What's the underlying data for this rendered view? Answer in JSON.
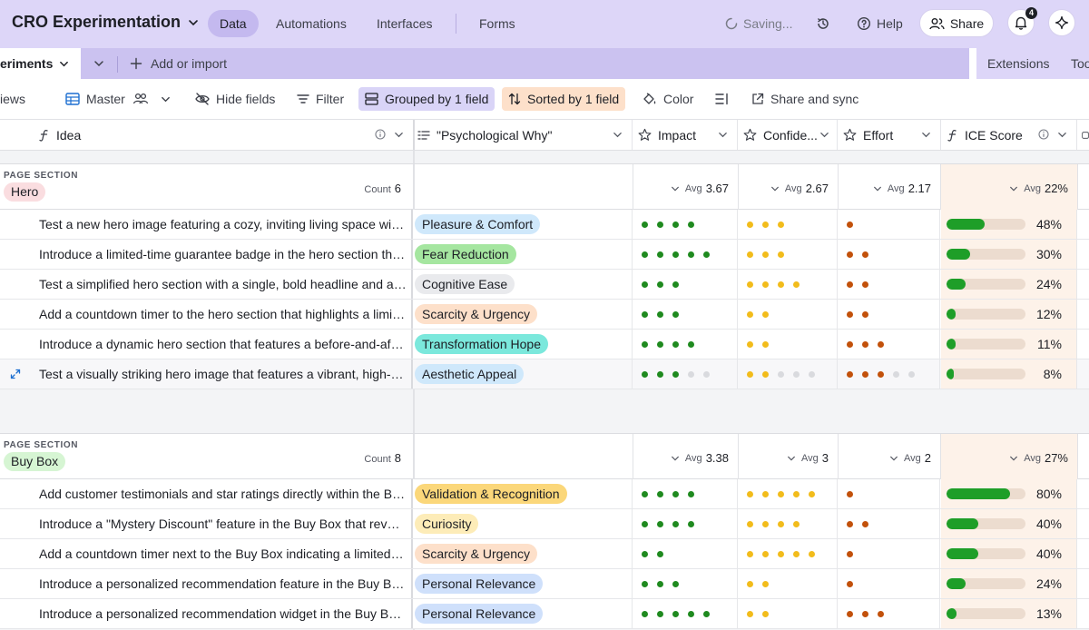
{
  "app": {
    "title": "CRO Experimentation",
    "nav_tabs": [
      {
        "label": "Data",
        "active": true
      },
      {
        "label": "Automations",
        "active": false
      },
      {
        "label": "Interfaces",
        "active": false
      },
      {
        "label": "Forms",
        "active": false
      }
    ],
    "saving_label": "Saving...",
    "help_label": "Help",
    "share_label": "Share",
    "notification_count": "4"
  },
  "tabbar": {
    "table_tab_label": "eriments",
    "add_import_label": "Add or import",
    "extensions_label": "Extensions",
    "tools_label": "Too"
  },
  "toolbar": {
    "views_label": "iews",
    "view_name": "Master",
    "hide_fields": "Hide fields",
    "filter": "Filter",
    "grouped": "Grouped by 1 field",
    "sorted": "Sorted by 1 field",
    "color": "Color",
    "share_sync": "Share and sync"
  },
  "columns": {
    "idea": "Idea",
    "why": "\"Psychological Why\"",
    "impact": "Impact",
    "confidence": "Confide...",
    "effort": "Effort",
    "ice": "ICE Score"
  },
  "colors": {
    "green": "#1f8a1f",
    "yellow": "#f2bc1b",
    "orange": "#c2510b",
    "empty": "#d9dade"
  },
  "groups": [
    {
      "section_label": "PAGE SECTION",
      "name": "Hero",
      "pill_color": "#fadde0",
      "count_label": "Count",
      "count": "6",
      "avg_label": "Avg",
      "avg_impact": "3.67",
      "avg_confidence": "2.67",
      "avg_effort": "2.17",
      "avg_ice": "22%",
      "rows": [
        {
          "idea": "Test a new hero image featuring a cozy, inviting living space with warm lighting and comfortable furniture",
          "why": "Pleasure & Comfort",
          "why_color": "#cfe8fb",
          "impact": 4,
          "impact_max": 4,
          "confidence": 3,
          "confidence_max": 3,
          "effort": 1,
          "effort_max": 1,
          "ice": "48%",
          "ice_fraction": 0.48
        },
        {
          "idea": "Introduce a limited-time guarantee badge in the hero section that emphasizes risk-free shopping",
          "why": "Fear Reduction",
          "why_color": "#a5e6a0",
          "impact": 5,
          "impact_max": 5,
          "confidence": 3,
          "confidence_max": 3,
          "effort": 2,
          "effort_max": 2,
          "ice": "30%",
          "ice_fraction": 0.3
        },
        {
          "idea": "Test a simplified hero section with a single, bold headline and a clear call to action",
          "why": "Cognitive Ease",
          "why_color": "#e9eaed",
          "impact": 3,
          "impact_max": 3,
          "confidence": 4,
          "confidence_max": 4,
          "effort": 2,
          "effort_max": 2,
          "ice": "24%",
          "ice_fraction": 0.24
        },
        {
          "idea": "Add a countdown timer to the hero section that highlights a limited-time offer",
          "why": "Scarcity & Urgency",
          "why_color": "#fde0ca",
          "impact": 3,
          "impact_max": 3,
          "confidence": 2,
          "confidence_max": 2,
          "effort": 2,
          "effort_max": 2,
          "ice": "12%",
          "ice_fraction": 0.12
        },
        {
          "idea": "Introduce a dynamic hero section that features a before-and-after transformation of a room",
          "why": "Transformation Hope",
          "why_color": "#7be8dc",
          "impact": 4,
          "impact_max": 4,
          "confidence": 2,
          "confidence_max": 2,
          "effort": 3,
          "effort_max": 3,
          "ice": "11%",
          "ice_fraction": 0.11
        },
        {
          "idea": "Test a visually striking hero image that features a vibrant, high-quality lifestyle scene",
          "why": "Aesthetic Appeal",
          "why_color": "#cfe8fb",
          "impact": 3,
          "impact_max": 5,
          "confidence": 2,
          "confidence_max": 5,
          "effort": 3,
          "effort_max": 5,
          "ice": "8%",
          "ice_fraction": 0.08,
          "hover": true
        }
      ]
    },
    {
      "section_label": "PAGE SECTION",
      "name": "Buy Box",
      "pill_color": "#d6f5d3",
      "count_label": "Count",
      "count": "8",
      "avg_label": "Avg",
      "avg_impact": "3.38",
      "avg_confidence": "3",
      "avg_effort": "2",
      "avg_ice": "27%",
      "rows": [
        {
          "idea": "Add customer testimonials and star ratings directly within the Buy Box",
          "why": "Validation & Recognition",
          "why_color": "#fbd77a",
          "impact": 4,
          "impact_max": 4,
          "confidence": 5,
          "confidence_max": 5,
          "effort": 1,
          "effort_max": 1,
          "ice": "80%",
          "ice_fraction": 0.8
        },
        {
          "idea": "Introduce a \"Mystery Discount\" feature in the Buy Box that reveals a surprise discount",
          "why": "Curiosity",
          "why_color": "#fdecb8",
          "impact": 4,
          "impact_max": 4,
          "confidence": 4,
          "confidence_max": 4,
          "effort": 2,
          "effort_max": 2,
          "ice": "40%",
          "ice_fraction": 0.4
        },
        {
          "idea": "Add a countdown timer next to the Buy Box indicating a limited-time offer",
          "why": "Scarcity & Urgency",
          "why_color": "#fde0ca",
          "impact": 2,
          "impact_max": 2,
          "confidence": 5,
          "confidence_max": 5,
          "effort": 1,
          "effort_max": 1,
          "ice": "40%",
          "ice_fraction": 0.4
        },
        {
          "idea": "Introduce a personalized recommendation feature in the Buy Box based on browsing history",
          "why": "Personal Relevance",
          "why_color": "#cfe0fb",
          "impact": 3,
          "impact_max": 3,
          "confidence": 2,
          "confidence_max": 2,
          "effort": 1,
          "effort_max": 1,
          "ice": "24%",
          "ice_fraction": 0.24
        },
        {
          "idea": "Introduce a personalized recommendation widget in the Buy Box that suggests complementary products",
          "why": "Personal Relevance",
          "why_color": "#cfe0fb",
          "impact": 5,
          "impact_max": 5,
          "confidence": 2,
          "confidence_max": 2,
          "effort": 3,
          "effort_max": 3,
          "ice": "13%",
          "ice_fraction": 0.13
        }
      ]
    }
  ]
}
